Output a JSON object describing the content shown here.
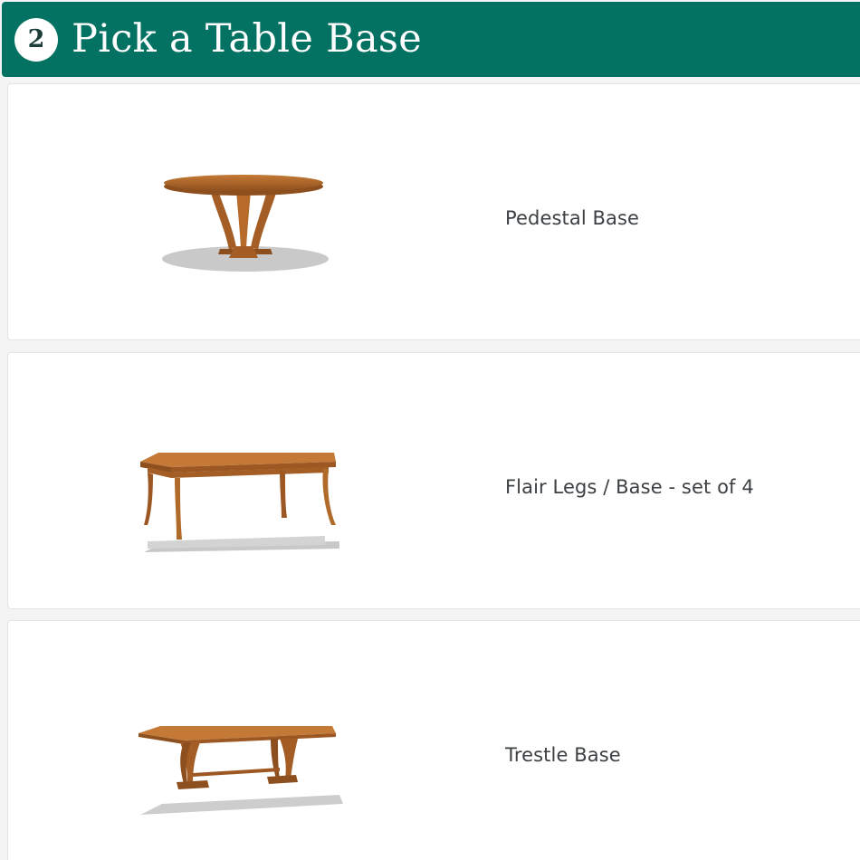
{
  "step": {
    "number": "2",
    "title": "Pick a Table Base"
  },
  "options": [
    {
      "label": "Pedestal Base",
      "image": "pedestal-table"
    },
    {
      "label": "Flair Legs / Base - set of 4",
      "image": "flair-legs-table"
    },
    {
      "label": "Trestle Base",
      "image": "trestle-table"
    }
  ],
  "colors": {
    "header_bg": "#047263",
    "wood": "#b56a2b",
    "label_text": "#3c4043"
  }
}
